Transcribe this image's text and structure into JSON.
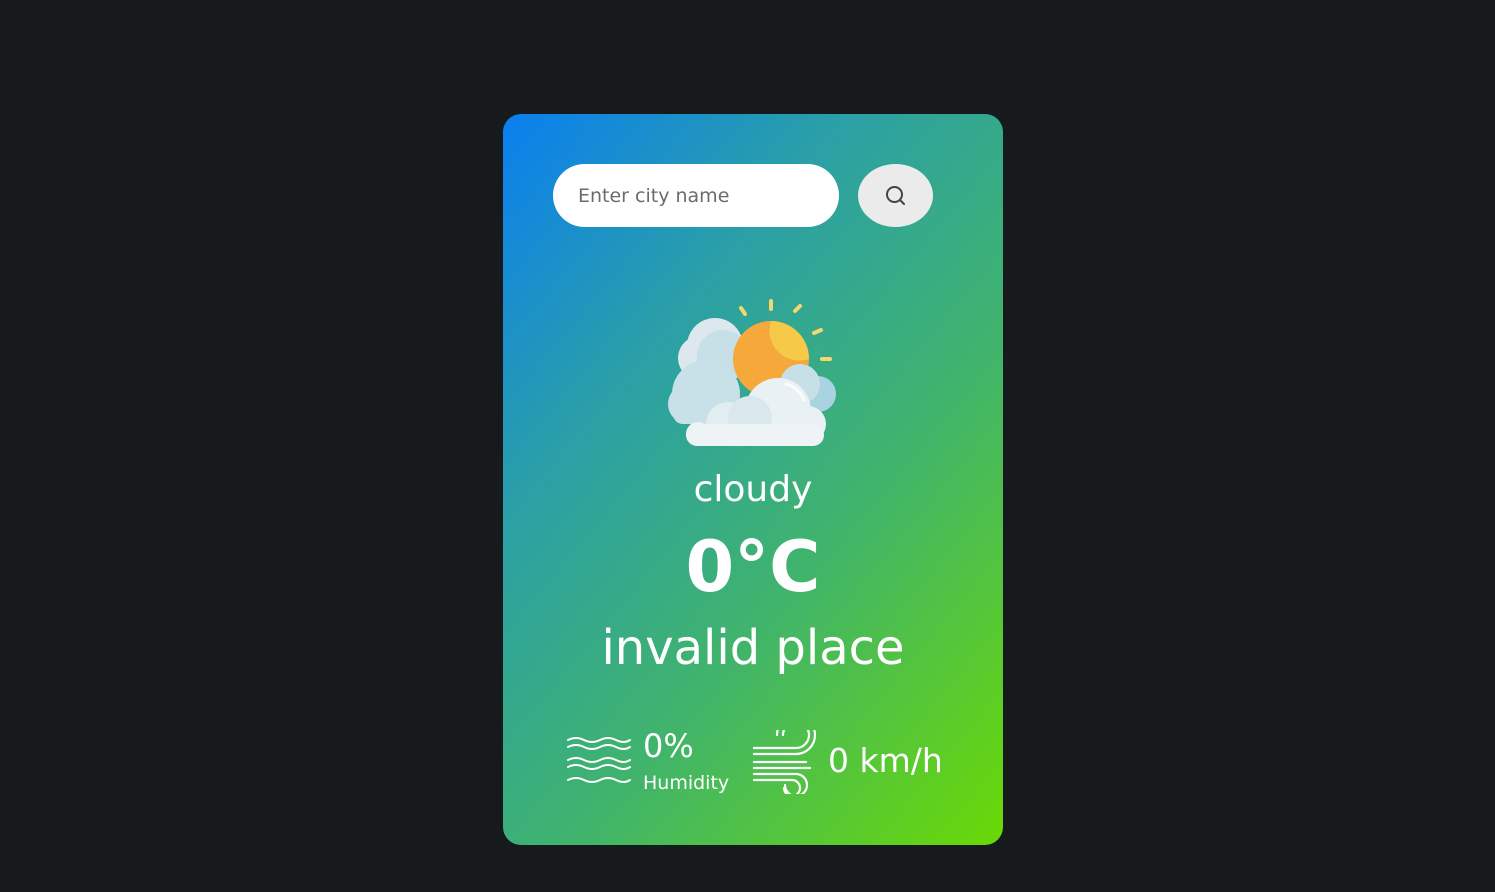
{
  "search": {
    "placeholder": "Enter city name",
    "value": ""
  },
  "icons": {
    "search_button": "search-icon",
    "weather": "partly-cloudy-icon",
    "humidity": "humidity-waves-icon",
    "wind": "wind-icon"
  },
  "weather": {
    "condition": "cloudy",
    "temperature": "0°C",
    "city": "invalid place"
  },
  "details": {
    "humidity_value": "0%",
    "humidity_label": "Humidity",
    "wind_value": "0 km/h"
  },
  "colors": {
    "page_background": "#161a1c",
    "card_gradient_start": "#0a7ff0",
    "card_gradient_end": "#6ad905",
    "text": "#ffffff",
    "search_button_background": "#ebebeb"
  }
}
